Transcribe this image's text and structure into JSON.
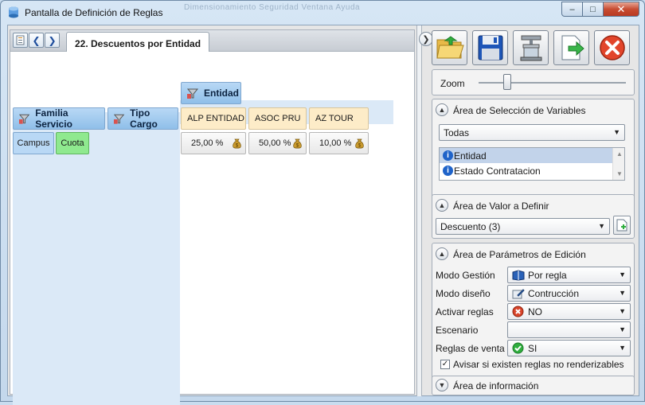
{
  "window": {
    "title": "Pantalla de Definición de Reglas",
    "ghost_menu": "Dimensionamiento    Seguridad    Ventana    Ayuda",
    "controls": {
      "minimize": "–",
      "maximize": "□",
      "close": "✕"
    }
  },
  "tab": {
    "label": "22. Descuentos por Entidad"
  },
  "grid": {
    "row_fields": [
      "Familia Servicio",
      "Tipo Cargo"
    ],
    "column_field": "Entidad",
    "columns": [
      "ALP ENTIDAD",
      "ASOC PRU",
      "AZ TOUR"
    ],
    "row_values": [
      "Campus",
      "Cuota"
    ],
    "cells": [
      "25,00 %",
      "50,00 %",
      "10,00 %"
    ]
  },
  "zoom": {
    "label": "Zoom",
    "level": 0.35
  },
  "variables_panel": {
    "title": "Área de Selección de Variables",
    "filter": "Todas",
    "items": [
      "Entidad",
      "Estado Contratacion"
    ]
  },
  "value_panel": {
    "title": "Área de Valor a Definir",
    "selected": "Descuento (3)"
  },
  "params_panel": {
    "title": "Área de Parámetros de Edición",
    "modo_gestion_label": "Modo Gestión",
    "modo_gestion_value": "Por regla",
    "modo_diseno_label": "Modo diseño",
    "modo_diseno_value": "Contrucción",
    "activar_label": "Activar reglas",
    "activar_value": "NO",
    "escenario_label": "Escenario",
    "escenario_value": "",
    "venta_label": "Reglas de venta",
    "venta_value": "SI",
    "avisar_label": "Avisar si existen reglas no renderizables",
    "avisar_checked": "✓"
  },
  "info_panel": {
    "title": "Área de información"
  },
  "colors": {
    "accent": "#8fbfe9",
    "col_header": "#fdecc8",
    "cuota": "#8fe98f"
  }
}
